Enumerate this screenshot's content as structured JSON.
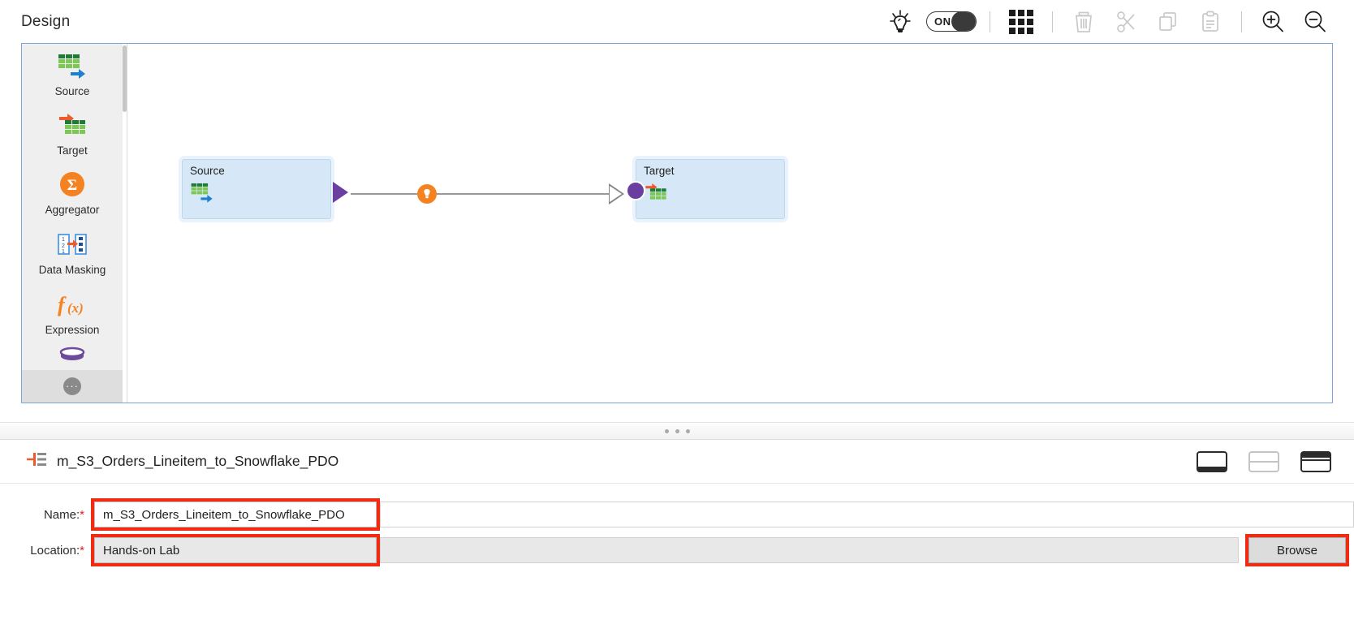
{
  "header": {
    "title": "Design",
    "toggle": {
      "label": "ON",
      "state": "on"
    },
    "icons": {
      "lightbulb": "lightbulb-icon",
      "grid": "grid-icon",
      "delete": "trash-icon",
      "cut": "scissors-icon",
      "copy": "copy-icon",
      "paste": "clipboard-paste-icon",
      "zoom_in": "zoom-in-icon",
      "zoom_out": "zoom-out-icon"
    }
  },
  "palette": {
    "items": [
      {
        "label": "Source",
        "icon": "source-table-icon"
      },
      {
        "label": "Target",
        "icon": "target-table-icon"
      },
      {
        "label": "Aggregator",
        "icon": "sigma-circle-icon"
      },
      {
        "label": "Data Masking",
        "icon": "data-masking-icon"
      },
      {
        "label": "Expression",
        "icon": "function-fx-icon"
      }
    ],
    "more_label": "···"
  },
  "canvas": {
    "nodes": [
      {
        "id": "source",
        "title": "Source",
        "icon": "source-table-icon"
      },
      {
        "id": "target",
        "title": "Target",
        "icon": "target-table-icon"
      }
    ],
    "link_badge_icon": "lightbulb-badge-icon"
  },
  "bottom_panel": {
    "title": "m_S3_Orders_Lineitem_to_Snowflake_PDO",
    "title_icon": "mapping-icon",
    "layout_buttons": [
      {
        "name": "panel-layout-bottom",
        "selected": true
      },
      {
        "name": "panel-layout-split",
        "selected": false
      },
      {
        "name": "panel-layout-full",
        "selected": false
      }
    ],
    "form": {
      "name": {
        "label": "Name:",
        "required_mark": "*",
        "value": "m_S3_Orders_Lineitem_to_Snowflake_PDO",
        "placeholder": "",
        "highlighted": true
      },
      "location": {
        "label": "Location:",
        "required_mark": "*",
        "value": "Hands-on Lab",
        "placeholder": "",
        "disabled": true,
        "highlighted": true
      },
      "browse_label": "Browse"
    }
  },
  "colors": {
    "accent_orange": "#f58220",
    "node_fill": "#d6e8f7",
    "port_purple": "#6b3fa0",
    "highlight_red": "#f02b12",
    "canvas_border": "#7aa7d8",
    "table_green": "#59b04a",
    "arrow_blue": "#1b7fd4"
  }
}
